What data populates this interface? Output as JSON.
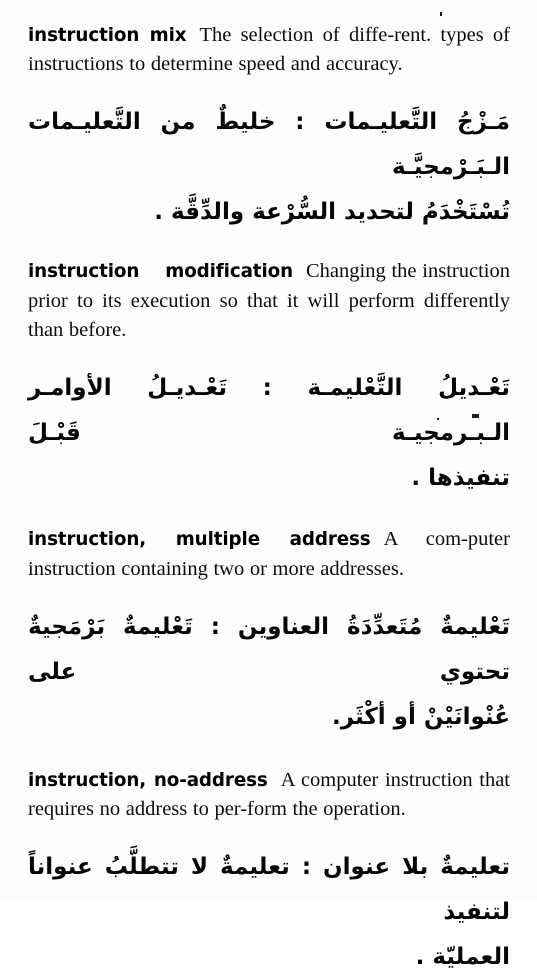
{
  "page": {
    "type": "dictionary-page",
    "background_color": "#fdfdfc",
    "text_color": "#000000",
    "language_pair": "English-Arabic"
  },
  "entries": [
    {
      "headword_part1": "instruction",
      "headword_part2": "mix",
      "definition_en": "The selection of diffe-rent. types of instructions to determine speed and accuracy.",
      "arabic_lines": [
        "مَـزْجُ التَّعليـمات : خليطٌ من التَّعليـمات الـبَـرْمجيَّـة",
        "تُسْتَخْدَمُ لتحديد السُّرْعة والدِّقَّة ."
      ]
    },
    {
      "headword_part1": "instruction",
      "headword_part2": "modification",
      "definition_en": "Changing the instruction prior to its execution so that it will perform differently than before.",
      "arabic_lines": [
        "تَعْـديلُ التَّعْليمـة : تَعْـديـلُ الأوامـر الـبـرمجيـة قَبْـلَ",
        "تنفيذها ."
      ]
    },
    {
      "headword_part1": "instruction, multiple address",
      "headword_part2": "",
      "definition_en": "A com-puter instruction containing two or more addresses.",
      "arabic_lines": [
        "تَعْليمةٌ مُتَعدِّدَةُ العناوين : تَعْليمةٌ بَرْمَجيةٌ تحتوي على",
        "عُنْوانَيْنْ أو أكْثَر."
      ]
    },
    {
      "headword_part1": "instruction, no-address",
      "headword_part2": "",
      "definition_en": "A computer instruction that requires no address to per-form the operation.",
      "arabic_lines": [
        "تعليمةٌ بلا عنوان : تعليمةٌ لا تتطلَّبُ عنواناً لتنفيذ",
        "العمليّة ."
      ]
    }
  ]
}
